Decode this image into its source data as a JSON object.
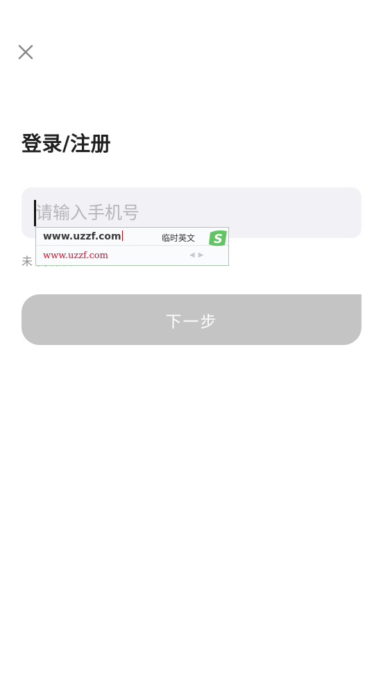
{
  "header": {
    "close_icon": "close-icon",
    "title": "登录/注册"
  },
  "form": {
    "phone_value": "",
    "phone_placeholder": "请输入手机号",
    "agreement_text": "未                                                                我语账户",
    "next_label": "下一步"
  },
  "ime": {
    "composition": "www.uzzf.com",
    "mode_label": "临时英文",
    "candidate": "www.uzzf.com",
    "logo_icon": "sogou-s-logo-icon",
    "prev_icon": "triangle-left-icon",
    "next_icon": "triangle-right-icon"
  },
  "colors": {
    "background": "#ffffff",
    "input_bg": "#f2f1f6",
    "button_disabled": "#c4c4c4",
    "title": "#1f1f1f",
    "ime_candidate": "#d0102a",
    "ime_logo": "#5ec05e"
  }
}
